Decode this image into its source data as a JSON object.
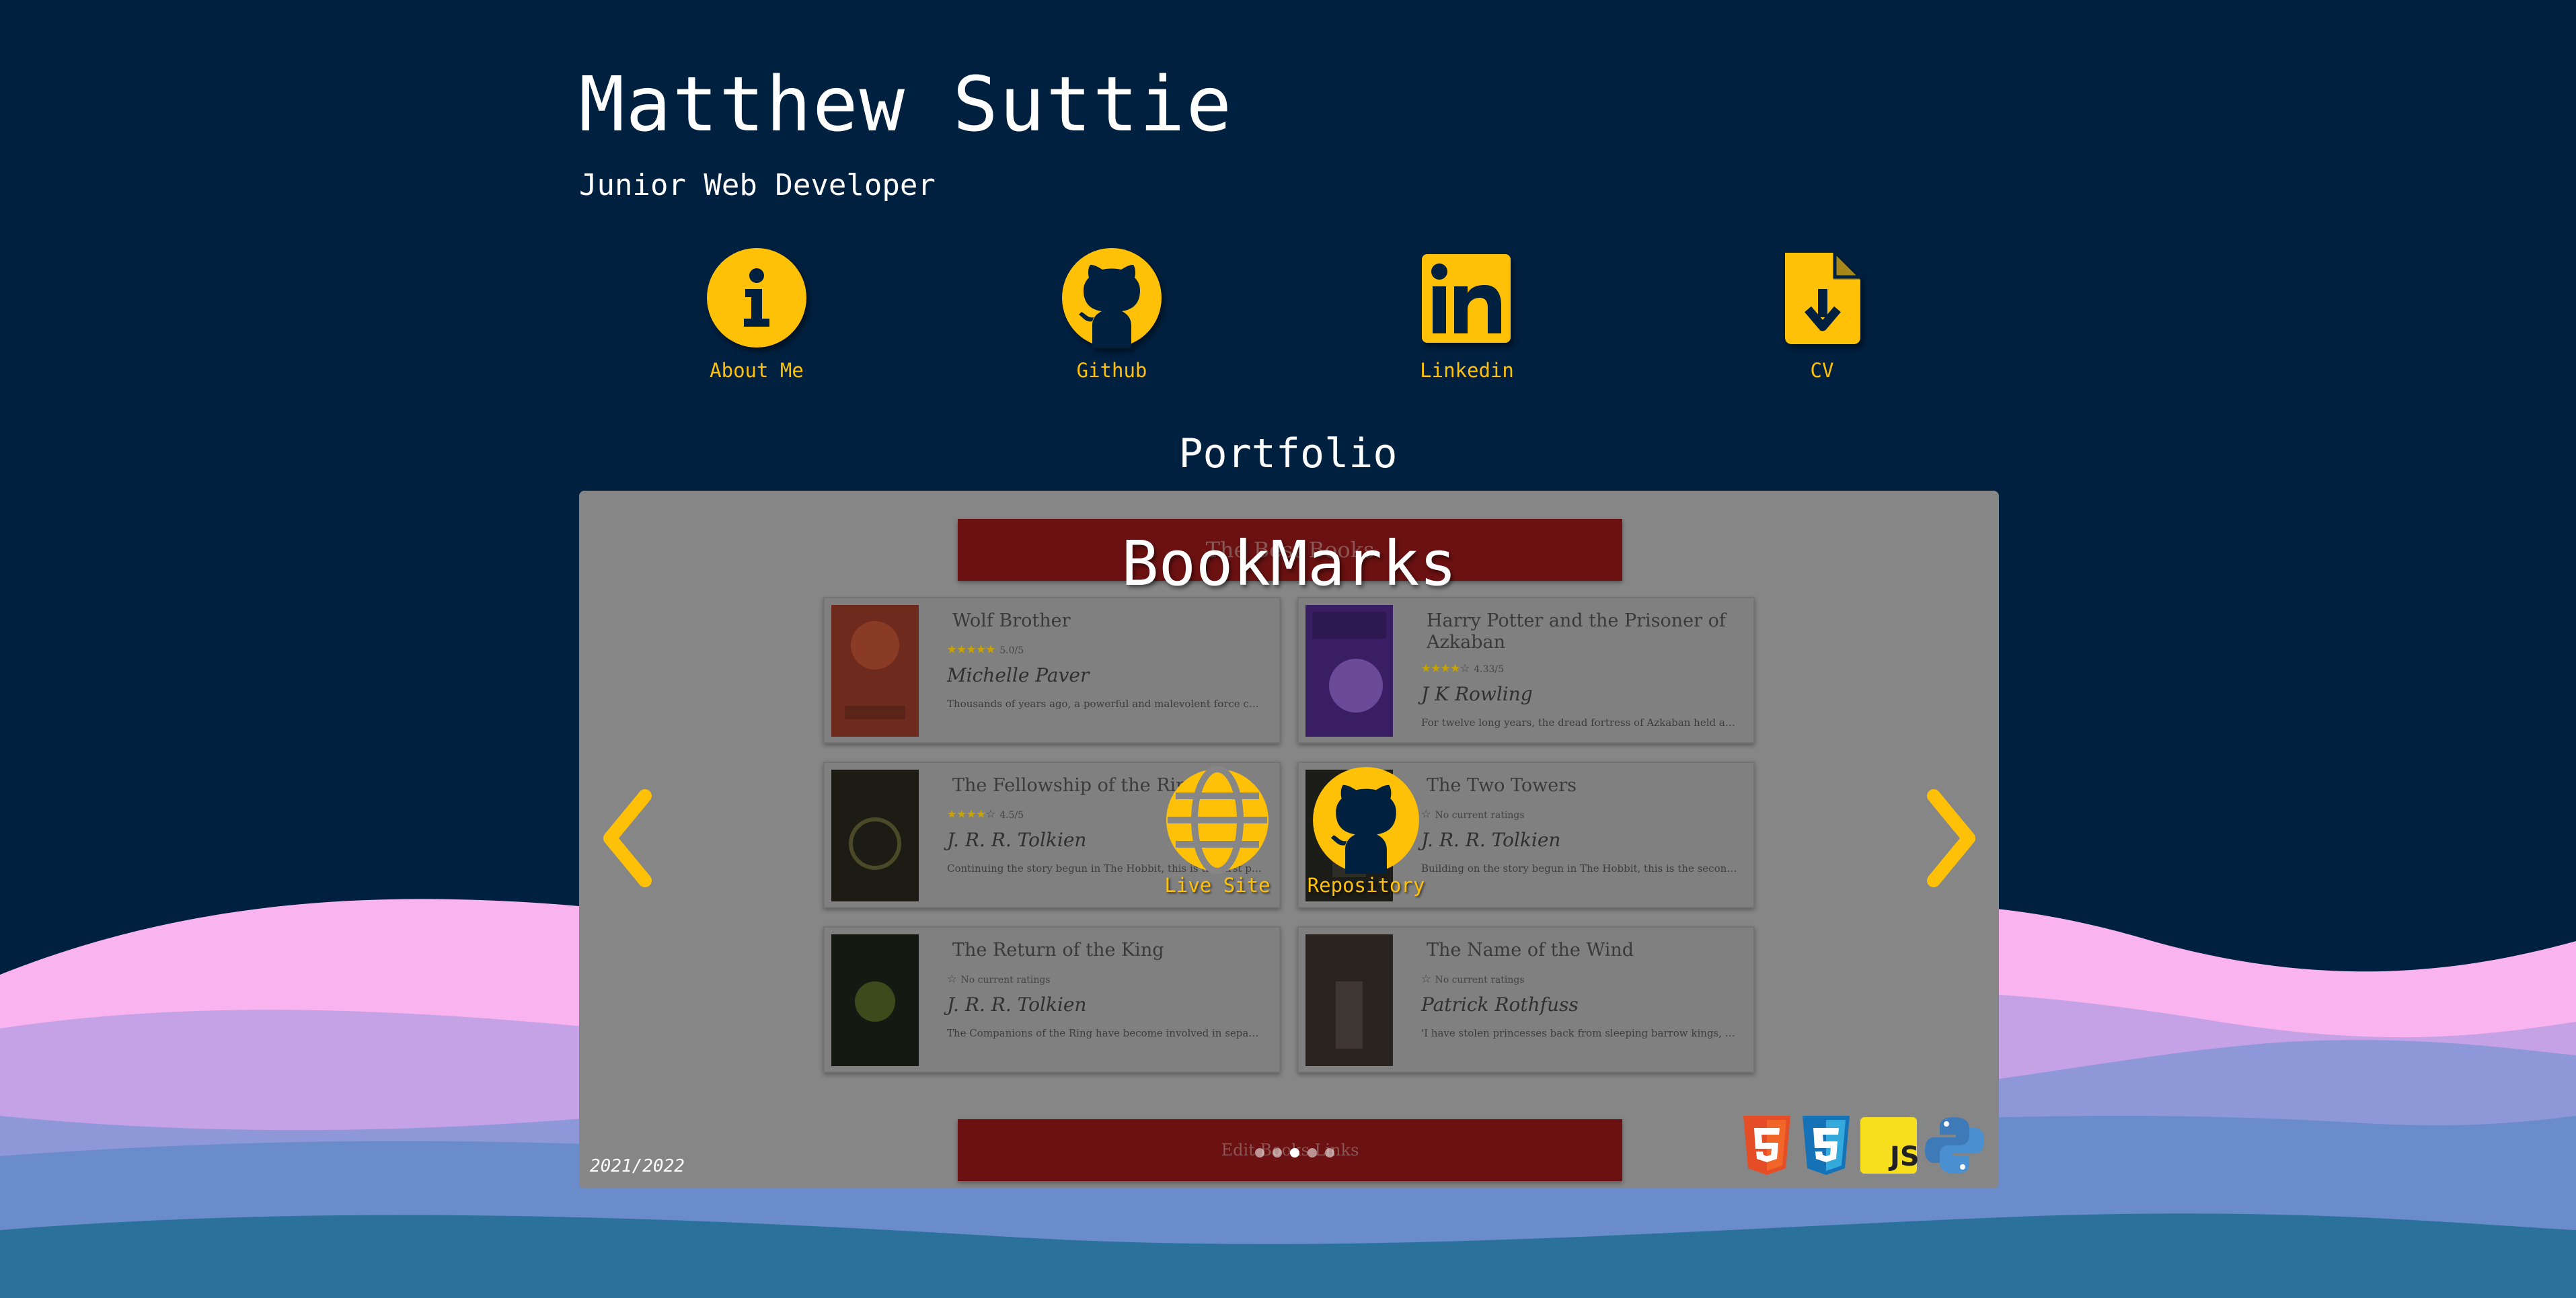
{
  "header": {
    "name": "Matthew Suttie",
    "tagline": "Junior Web Developer"
  },
  "social": [
    {
      "label": "About Me",
      "icon": "info-circle-icon"
    },
    {
      "label": "Github",
      "icon": "github-icon"
    },
    {
      "label": "Linkedin",
      "icon": "linkedin-icon"
    },
    {
      "label": "CV",
      "icon": "file-download-icon"
    }
  ],
  "portfolio": {
    "heading": "Portfolio",
    "project": {
      "title": "BookMarks",
      "date": "2021/2022",
      "live_label": "Live Site",
      "repo_label": "Repository",
      "tech": [
        "html5-icon",
        "css3-icon",
        "js-icon",
        "python-icon"
      ],
      "tech_js_text": "JS"
    },
    "screenshot": {
      "banner_text": "The Best Books",
      "footer_text": "Edit Books Links",
      "books": [
        {
          "title": "Wolf Brother",
          "rating": "5.0/5",
          "stars": 5,
          "author": "Michelle Paver",
          "desc": "Thousands of years ago, a powerful and malevolent force conju..."
        },
        {
          "title": "Harry Potter and the Prisoner of Azkaban",
          "rating": "4.33/5",
          "stars": 4,
          "author": "J K Rowling",
          "desc": "For twelve long years, the dread fortress of Azkaban held an inf..."
        },
        {
          "title": "The Fellowship of the Ring",
          "rating": "4.5/5",
          "stars": 4,
          "author": "J. R. R. Tolkien",
          "desc": "Continuing the story begun in The Hobbit, this is the first part o..."
        },
        {
          "title": "The Two Towers",
          "rating": "No current ratings",
          "stars": 0,
          "author": "J. R. R. Tolkien",
          "desc": "Building on the story begun in The Hobbit, this is the second p..."
        },
        {
          "title": "The Return of the King",
          "rating": "No current ratings",
          "stars": 0,
          "author": "J. R. R. Tolkien",
          "desc": "The Companions of the Ring have become involved in separate..."
        },
        {
          "title": "The Name of the Wind",
          "rating": "No current ratings",
          "stars": 0,
          "author": "Patrick Rothfuss",
          "desc": "'I have stolen princesses back from sleeping barrow kings, I bur..."
        }
      ]
    }
  },
  "colors": {
    "background": "#00203f",
    "accent": "#ffc107",
    "carousel": "#868686",
    "site_banner": "#6b1111"
  }
}
